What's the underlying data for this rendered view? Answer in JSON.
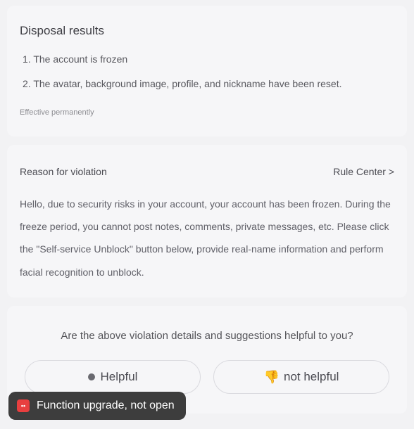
{
  "disposal": {
    "title": "Disposal results",
    "items": [
      "1. The account is frozen",
      "2. The avatar, background image, profile, and nickname have been reset."
    ],
    "effective": "Effective permanently"
  },
  "reason": {
    "title": "Reason for violation",
    "rule_center": "Rule Center >",
    "body": "Hello, due to security risks in your account, your account has been frozen. During the freeze period, you cannot post notes, comments, private messages, etc. Please click the \"Self-service Unblock\" button below, provide real-name information and perform facial recognition to unblock."
  },
  "feedback": {
    "question": "Are the above violation details and suggestions helpful to you?",
    "helpful_label": "Helpful",
    "not_helpful_label": "not helpful"
  },
  "toast": {
    "text": "Function upgrade, not open"
  }
}
